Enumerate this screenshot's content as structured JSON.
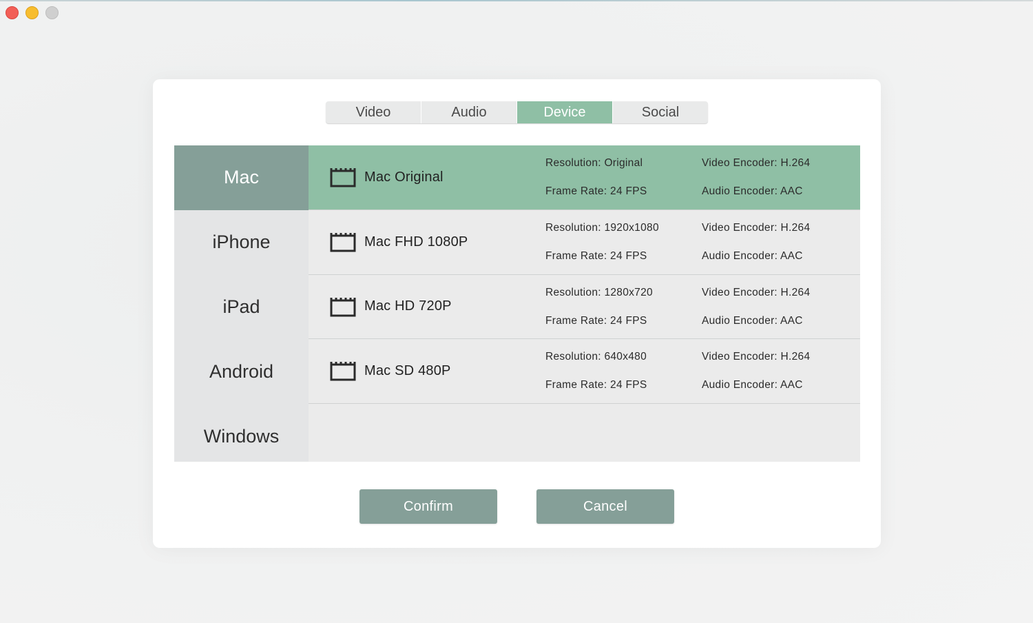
{
  "window": {
    "controls": [
      "close",
      "minimize",
      "maximize"
    ]
  },
  "tabs": [
    {
      "label": "Video",
      "active": false
    },
    {
      "label": "Audio",
      "active": false
    },
    {
      "label": "Device",
      "active": true
    },
    {
      "label": "Social",
      "active": false
    }
  ],
  "categories": [
    {
      "label": "Mac",
      "active": true
    },
    {
      "label": "iPhone",
      "active": false
    },
    {
      "label": "iPad",
      "active": false
    },
    {
      "label": "Android",
      "active": false
    },
    {
      "label": "Windows",
      "active": false
    }
  ],
  "presets": [
    {
      "icon": "clapperboard-icon",
      "name": "Mac Original",
      "resolution": "Resolution: Original",
      "frame_rate": "Frame Rate: 24 FPS",
      "video_encoder": "Video Encoder: H.264",
      "audio_encoder": "Audio Encoder: AAC",
      "selected": true
    },
    {
      "icon": "clapperboard-icon",
      "name": "Mac FHD 1080P",
      "resolution": "Resolution: 1920x1080",
      "frame_rate": "Frame Rate: 24 FPS",
      "video_encoder": "Video Encoder: H.264",
      "audio_encoder": "Audio Encoder: AAC",
      "selected": false
    },
    {
      "icon": "clapperboard-icon",
      "name": "Mac HD 720P",
      "resolution": "Resolution: 1280x720",
      "frame_rate": "Frame Rate: 24 FPS",
      "video_encoder": "Video Encoder: H.264",
      "audio_encoder": "Audio Encoder: AAC",
      "selected": false
    },
    {
      "icon": "clapperboard-icon",
      "name": "Mac SD 480P",
      "resolution": "Resolution: 640x480",
      "frame_rate": "Frame Rate: 24 FPS",
      "video_encoder": "Video Encoder: H.264",
      "audio_encoder": "Audio Encoder: AAC",
      "selected": false
    }
  ],
  "buttons": {
    "confirm_label": "Confirm",
    "cancel_label": "Cancel"
  },
  "colors": {
    "accent_green": "#8fbfa5",
    "sidebar_selected": "#859f98",
    "button_bg": "#859f98"
  }
}
